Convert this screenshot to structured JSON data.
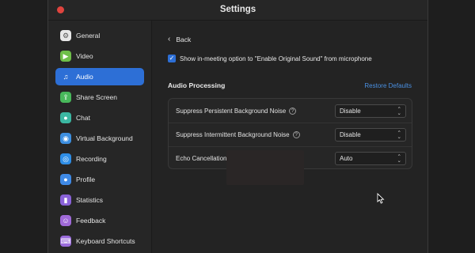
{
  "window": {
    "title": "Settings"
  },
  "sidebar": {
    "items": [
      {
        "label": "General",
        "icon": "gear-icon",
        "color": "#e8e8e8",
        "glyph": "⚙",
        "active": false
      },
      {
        "label": "Video",
        "icon": "video-camera-icon",
        "color": "#6fbf49",
        "glyph": "▶",
        "active": false
      },
      {
        "label": "Audio",
        "icon": "headphones-icon",
        "color": "#2d6fd6",
        "glyph": "♫",
        "active": true
      },
      {
        "label": "Share Screen",
        "icon": "share-screen-icon",
        "color": "#48b85b",
        "glyph": "⇪",
        "active": false
      },
      {
        "label": "Chat",
        "icon": "chat-bubble-icon",
        "color": "#3bb7a2",
        "glyph": "●",
        "active": false
      },
      {
        "label": "Virtual Background",
        "icon": "person-background-icon",
        "color": "#3d8fe0",
        "glyph": "◉",
        "active": false
      },
      {
        "label": "Recording",
        "icon": "record-icon",
        "color": "#2f8ee6",
        "glyph": "◎",
        "active": false
      },
      {
        "label": "Profile",
        "icon": "profile-icon",
        "color": "#3f8ae6",
        "glyph": "●",
        "active": false
      },
      {
        "label": "Statistics",
        "icon": "statistics-icon",
        "color": "#8a62d8",
        "glyph": "▮",
        "active": false
      },
      {
        "label": "Feedback",
        "icon": "feedback-smiley-icon",
        "color": "#a06ad8",
        "glyph": "☺",
        "active": false
      },
      {
        "label": "Keyboard Shortcuts",
        "icon": "keyboard-icon",
        "color": "#9a6bdb",
        "glyph": "⌨",
        "active": false
      }
    ]
  },
  "content": {
    "back_label": "Back",
    "original_sound_option": {
      "checked": true,
      "label": "Show in-meeting option to \"Enable Original Sound\" from microphone"
    },
    "section_title": "Audio Processing",
    "restore_label": "Restore Defaults",
    "settings": [
      {
        "label": "Suppress Persistent Background Noise",
        "help": true,
        "value": "Disable"
      },
      {
        "label": "Suppress Intermittent Background Noise",
        "help": true,
        "value": "Disable"
      },
      {
        "label": "Echo Cancellation",
        "help": false,
        "value": "Auto"
      }
    ]
  },
  "colors": {
    "accent": "#2d6fd6",
    "link": "#4a90e2",
    "close_button": "#e0443e"
  }
}
